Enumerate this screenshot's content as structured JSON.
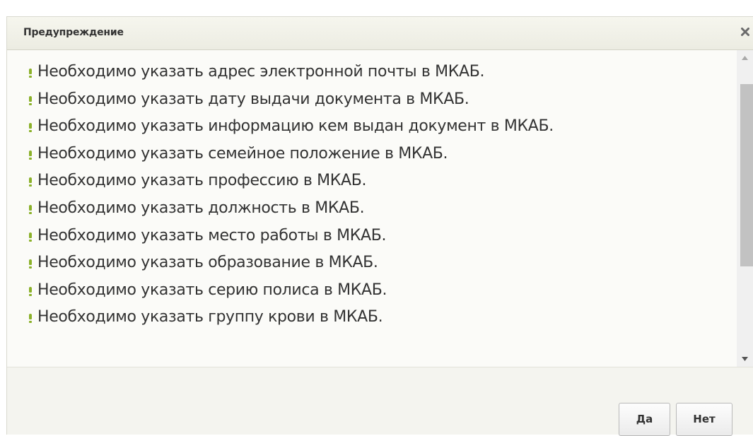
{
  "dialog": {
    "title": "Предупреждение",
    "close_icon": "close-icon"
  },
  "messages": [
    {
      "icon": "warning-icon",
      "text": "Необходимо указать адрес электронной почты в МКАБ."
    },
    {
      "icon": "warning-icon",
      "text": "Необходимо указать дату выдачи документа в МКАБ."
    },
    {
      "icon": "warning-icon",
      "text": "Необходимо указать информацию кем выдан документ в МКАБ."
    },
    {
      "icon": "warning-icon",
      "text": "Необходимо указать семейное положение в МКАБ."
    },
    {
      "icon": "warning-icon",
      "text": "Необходимо указать профессию в МКАБ."
    },
    {
      "icon": "warning-icon",
      "text": "Необходимо указать должность в МКАБ."
    },
    {
      "icon": "warning-icon",
      "text": "Необходимо указать место работы в МКАБ."
    },
    {
      "icon": "warning-icon",
      "text": "Необходимо указать образование в МКАБ."
    },
    {
      "icon": "warning-icon",
      "text": "Необходимо указать серию полиса в МКАБ."
    },
    {
      "icon": "warning-icon",
      "text": "Необходимо указать группу крови в МКАБ."
    }
  ],
  "buttons": {
    "yes_label": "Да",
    "no_label": "Нет"
  },
  "colors": {
    "warning_icon": "#8bb12a",
    "text": "#333333",
    "scroll_thumb": "#c2c2c2"
  }
}
